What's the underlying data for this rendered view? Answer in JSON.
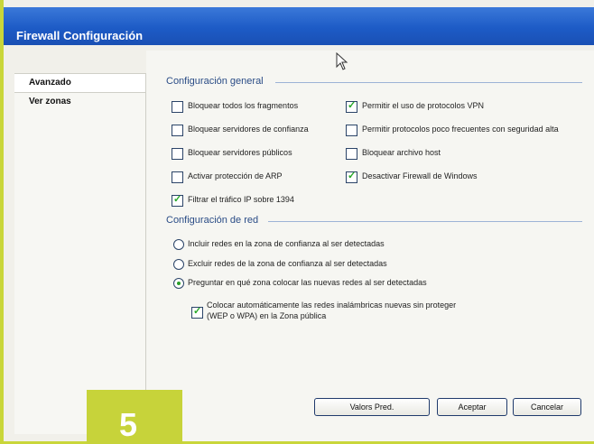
{
  "window": {
    "title": "Firewall Configuración"
  },
  "sidebar": {
    "items": [
      {
        "label": "Avanzado"
      },
      {
        "label": "Ver zonas"
      }
    ]
  },
  "general": {
    "title": "Configuración general",
    "left": [
      {
        "label": "Bloquear todos los fragmentos",
        "checked": false
      },
      {
        "label": "Bloquear servidores de confianza",
        "checked": false
      },
      {
        "label": "Bloquear servidores públicos",
        "checked": false
      },
      {
        "label": "Activar protección de ARP",
        "checked": false
      },
      {
        "label": "Filtrar el tráfico IP sobre 1394",
        "checked": true
      }
    ],
    "right": [
      {
        "label": "Permitir el uso de protocolos VPN",
        "checked": true
      },
      {
        "label": "Permitir protocolos poco frecuentes con seguridad alta",
        "checked": false
      },
      {
        "label": "Bloquear archivo host",
        "checked": false
      },
      {
        "label": "Desactivar Firewall de Windows",
        "checked": true
      }
    ]
  },
  "network": {
    "title": "Configuración de red",
    "radios": [
      {
        "label": "Incluir redes en la zona de confianza al ser detectadas",
        "checked": false
      },
      {
        "label": "Excluir redes de la zona de confianza al ser detectadas",
        "checked": false
      },
      {
        "label": "Preguntar en qué zona colocar las nuevas redes al ser detectadas",
        "checked": true
      }
    ],
    "wireless": {
      "line1": "Colocar automáticamente las redes inalámbricas nuevas sin proteger",
      "line2": "(WEP o WPA) en la Zona pública",
      "checked": true
    }
  },
  "buttons": {
    "defaults": "Valors Pred.",
    "accept": "Aceptar",
    "cancel": "Cancelar"
  },
  "badge": {
    "text": "5"
  }
}
